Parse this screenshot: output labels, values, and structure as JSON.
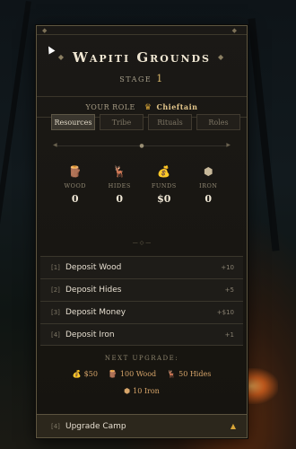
{
  "title": "Wapiti Grounds",
  "stage": {
    "label": "Stage",
    "value": "1"
  },
  "role": {
    "label": "Your Role",
    "value": "Chieftain",
    "icon": "crown-icon"
  },
  "tabs": [
    {
      "label": "Resources",
      "active": true
    },
    {
      "label": "Tribe",
      "active": false
    },
    {
      "label": "Rituals",
      "active": false
    },
    {
      "label": "Roles",
      "active": false
    }
  ],
  "resources": [
    {
      "label": "WOOD",
      "value": "0",
      "icon": "wood-icon"
    },
    {
      "label": "HIDES",
      "value": "0",
      "icon": "deer-icon"
    },
    {
      "label": "FUNDS",
      "value": "$0",
      "icon": "money-bag-icon"
    },
    {
      "label": "IRON",
      "value": "0",
      "icon": "iron-icon"
    }
  ],
  "actions": [
    {
      "key": "[1]",
      "label": "Deposit Wood",
      "reward": "+10"
    },
    {
      "key": "[2]",
      "label": "Deposit Hides",
      "reward": "+5"
    },
    {
      "key": "[3]",
      "label": "Deposit Money",
      "reward": "+$10"
    },
    {
      "key": "[4]",
      "label": "Deposit Iron",
      "reward": "+1"
    }
  ],
  "next_upgrade": {
    "heading": "NEXT UPGRADE:",
    "costs": [
      {
        "text": "$50",
        "icon": "money-bag-icon"
      },
      {
        "text": "100 Wood",
        "icon": "wood-icon"
      },
      {
        "text": "50 Hides",
        "icon": "deer-icon"
      },
      {
        "text": "10 Iron",
        "icon": "iron-icon"
      }
    ]
  },
  "upgrade_camp": {
    "key": "[4]",
    "label": "Upgrade Camp"
  },
  "colors": {
    "accent": "#d9a638",
    "panel": "#1b1916",
    "border": "#5e5640"
  }
}
